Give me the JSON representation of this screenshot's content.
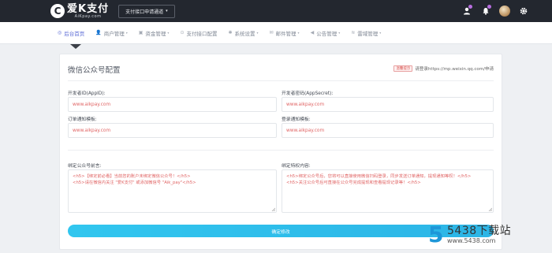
{
  "topbar": {
    "logo_mark": "C",
    "logo_title": "爱K支付",
    "logo_sub": "AiKpay.com",
    "switch_label": "支付接口申请通道",
    "colors": {
      "bg": "#23272f",
      "dot": "#b86ee0"
    },
    "icons": [
      "user-icon",
      "bell-icon",
      "avatar",
      "gear-icon"
    ]
  },
  "nav": {
    "items": [
      {
        "label": "后台首页",
        "icon": "dashboard-icon",
        "caret": false,
        "active": true
      },
      {
        "label": "商户管理",
        "icon": "user-icon",
        "caret": true,
        "active": false
      },
      {
        "label": "资金管理",
        "icon": "money-icon",
        "caret": true,
        "active": false
      },
      {
        "label": "支付接口配置",
        "icon": "settings-icon",
        "caret": false,
        "active": false
      },
      {
        "label": "系统设置",
        "icon": "gear-icon",
        "caret": true,
        "active": false
      },
      {
        "label": "邮件管理",
        "icon": "mail-icon",
        "caret": true,
        "active": false
      },
      {
        "label": "公告管理",
        "icon": "announce-icon",
        "caret": true,
        "active": false
      },
      {
        "label": "雷域管理",
        "icon": "wifi-icon",
        "caret": true,
        "active": false
      }
    ],
    "active_color": "#5b6bd6"
  },
  "form": {
    "title": "微信公众号配置",
    "hint_tag": "温馨提示",
    "hint_text": "请登录https://mp.weixin.qq.com/申请",
    "appid_label": "开发者ID(AppID):",
    "appid_value": "www.aikpay.com",
    "secret_label": "开发者密码(AppSecret):",
    "secret_value": "www.aikpay.com",
    "order_tpl_label": "订单通知模板:",
    "order_tpl_value": "www.aikpay.com",
    "login_tpl_label": "登录通知模板:",
    "login_tpl_value": "www.aikpay.com",
    "prefix_label": "绑定公众号前言:",
    "prefix_line1": "<h5>【绑定前必看】当前您的账户未绑定微信公众号！</h5>",
    "prefix_line2": "<h5>请在微信内关注 \"爱K支付\" 或添加微信号 \"Aik_pay\"</h5>",
    "special_label": "绑定特权内容:",
    "special_line1": "<h5>绑定公众号后，您将可以直接使用微信扫码登录，同步发送订单通知，提现通知等权！</h5>",
    "special_line2": "<h5>关注公众号后可直接在公众号完成提现和查看提现记录等！</h5>",
    "submit_label": "确定修改",
    "colors": {
      "value_text": "#e06464",
      "button": "#31c6ef"
    }
  },
  "watermark": {
    "mark": "5",
    "title": "5438下载站",
    "url": "www.5438.com"
  }
}
